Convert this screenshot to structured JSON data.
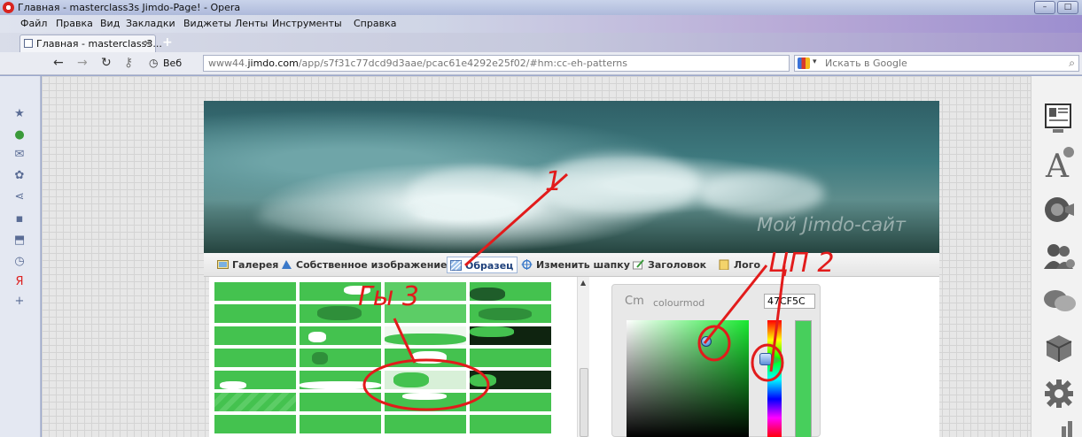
{
  "window": {
    "title": "Главная - masterclass3s Jimdo-Page! - Opera",
    "controls": [
      "–",
      "□"
    ]
  },
  "menu": [
    "Файл",
    "Правка",
    "Вид",
    "Закладки",
    "Виджеты",
    "Ленты",
    "Инструменты",
    "Справка"
  ],
  "tab": {
    "label": "Главная - masterclass3...",
    "close": "×",
    "new_tab": "+"
  },
  "nav": {
    "back": "←",
    "forward": "→",
    "reload": "↻",
    "key": "⚷",
    "web_icon": "◷",
    "web_label": "Веб",
    "url_prefix": "www44.",
    "url_domain": "jimdo.com",
    "url_path": "/app/s7f31c77dcd9d3aae/pcac61e4292e25f02/#hm:cc-eh-patterns",
    "search_placeholder": "Искать в Google",
    "search_icon": "⌕",
    "search_drop": "▾"
  },
  "left_panel_icons": [
    "★",
    "●",
    "✉",
    "✿",
    "⋖",
    "▪",
    "⬒",
    "◷",
    "Я",
    "+"
  ],
  "header": {
    "site_title": "Мой Jimdo-сайт"
  },
  "toolbar": {
    "gallery": "Галерея",
    "own_image": "Собственное изображение",
    "pattern": "Образец",
    "change_header": "Изменить шапку",
    "heading": "Заголовок",
    "logo": "Лого"
  },
  "colourmod": {
    "logo": "Cm",
    "label": "colourmod",
    "hex": "47CF5C",
    "arrow": "▶",
    "hue_value": 0.33
  },
  "scrollbar": {
    "up": "▲"
  },
  "annotations": {
    "a1": "1",
    "a2": "ЦП 2",
    "a3": "Гы 3"
  },
  "colors": {
    "accent_green": "#47CF5C",
    "annotation_red": "#e21b1b"
  }
}
